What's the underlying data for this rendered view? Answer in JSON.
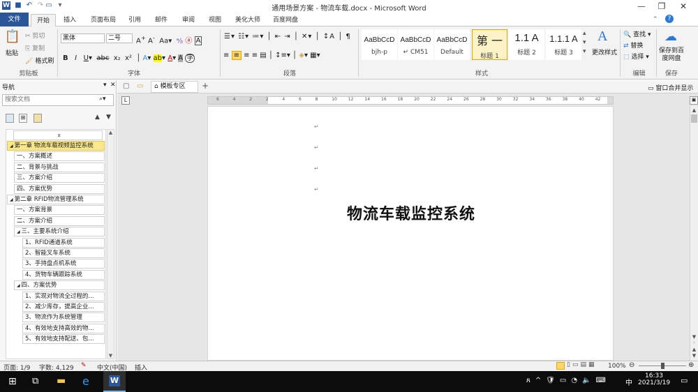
{
  "window": {
    "title": "通用场景方案 - 物流车载.docx - Microsoft Word",
    "controls": {
      "minimize": "—",
      "restore": "❐",
      "close": "✕"
    }
  },
  "ribbon_tabs": [
    "文件",
    "开始",
    "插入",
    "页面布局",
    "引用",
    "邮件",
    "审阅",
    "视图",
    "美化大师",
    "百度网盘"
  ],
  "ribbon": {
    "clipboard": {
      "paste": "粘贴",
      "cut": "剪切",
      "copy": "复制",
      "format_painter": "格式刷",
      "label": "剪贴板"
    },
    "font": {
      "name": "黑体",
      "size": "二号",
      "label": "字体"
    },
    "paragraph": {
      "label": "段落"
    },
    "styles": {
      "items": [
        {
          "preview": "AaBbCcD",
          "name": "bjh-p"
        },
        {
          "preview": "AaBbCcD",
          "name": "↵ CM51"
        },
        {
          "preview": "AaBbCcD",
          "name": "Default"
        },
        {
          "preview": "第 一",
          "name": "标题 1"
        },
        {
          "preview": "1.1 A",
          "name": "标题 2"
        },
        {
          "preview": "1.1.1 A",
          "name": "标题 3"
        }
      ],
      "change": "更改样式",
      "label": "样式"
    },
    "editing": {
      "find": "查找",
      "replace": "替换",
      "select": "选择",
      "label": "编辑"
    },
    "save": {
      "button": "保存到百度网盘",
      "label": "保存"
    }
  },
  "nav_pane": {
    "title": "导航",
    "search_placeholder": "搜索文档",
    "items": [
      {
        "text": "第一章  物流车载视频监控系统",
        "level": 0,
        "selected": true
      },
      {
        "text": "一、方案概述",
        "level": 1
      },
      {
        "text": "二、背景与挑战",
        "level": 1
      },
      {
        "text": "三、方案介绍",
        "level": 1
      },
      {
        "text": "四、方案优势",
        "level": 1
      },
      {
        "text": "第二章 RFID物流管理系统",
        "level": 0
      },
      {
        "text": "一、方案背景",
        "level": 1
      },
      {
        "text": "二、方案介绍",
        "level": 1
      },
      {
        "text": "三、主要系统介绍",
        "level": 1,
        "expander": true
      },
      {
        "text": "1、RFID通道系统",
        "level": 2
      },
      {
        "text": "2、智能叉车系统",
        "level": 2
      },
      {
        "text": "3、手持盘点机系统",
        "level": 2
      },
      {
        "text": "4、货物车辆跟踪系统",
        "level": 2
      },
      {
        "text": "四、方案优势",
        "level": 1,
        "expander": true
      },
      {
        "text": "1、实现对物流全过程的...",
        "level": 2
      },
      {
        "text": "2、减少库存，提高企业...",
        "level": 2
      },
      {
        "text": "3、物流作为系统管理",
        "level": 2
      },
      {
        "text": "4、有效地支持高效的物...",
        "level": 2
      },
      {
        "text": "5、有效地支持配送、包...",
        "level": 2
      }
    ]
  },
  "doc_tabs": {
    "template": "模板专区",
    "merge": "窗口合并显示"
  },
  "ruler": [
    "6",
    "4",
    "2",
    "2",
    "4",
    "6",
    "8",
    "10",
    "12",
    "14",
    "16",
    "18",
    "20",
    "22",
    "24",
    "26",
    "28",
    "30",
    "32",
    "34",
    "36",
    "38",
    "40",
    "42"
  ],
  "document": {
    "title": "物流车载监控系统",
    "para_mark": "↵"
  },
  "status": {
    "page": "页面: 1/9",
    "words": "字数: 4,129",
    "lang": "中文(中国)",
    "mode": "插入",
    "zoom": "100%"
  },
  "taskbar": {
    "time": "16:33",
    "date": "2021/3/19",
    "ime": "中"
  }
}
